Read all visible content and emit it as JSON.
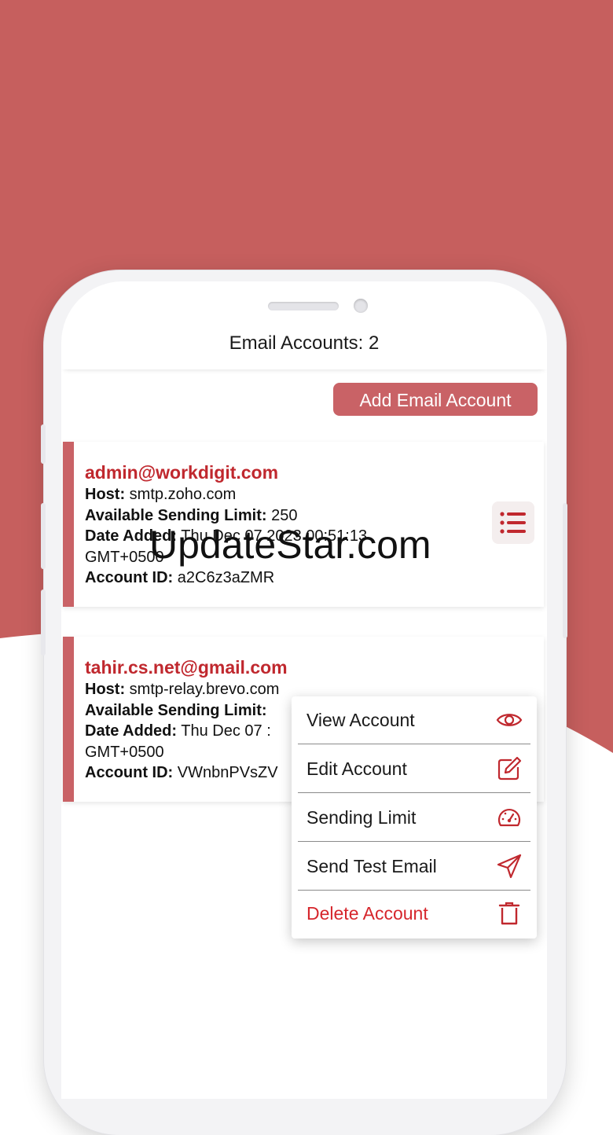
{
  "colors": {
    "background_red": "#c65f5e",
    "accent": "#c96266",
    "email_text": "#c0282e",
    "danger": "#d6262c"
  },
  "header": {
    "title": "Email Accounts: 2"
  },
  "toolbar": {
    "add_label": "Add Email Account"
  },
  "labels": {
    "host": "Host:",
    "limit": "Available Sending Limit:",
    "date": "Date Added:",
    "account_id": "Account ID:"
  },
  "accounts": [
    {
      "email": "admin@workdigit.com",
      "host": "smtp.zoho.com",
      "limit": "250",
      "date_line1": "Thu Dec 07 2023 00:51:13",
      "date_line2": "GMT+0500",
      "account_id": "a2C6z3aZMR",
      "menu_icon": "list-icon"
    },
    {
      "email": "tahir.cs.net@gmail.com",
      "host": "smtp-relay.brevo.com",
      "limit": "",
      "date_line1": "Thu Dec 07 :",
      "date_line2": "GMT+0500",
      "account_id": "VWnbnPVsZV"
    }
  ],
  "context_menu": {
    "items": [
      {
        "label": "View Account",
        "icon": "eye-icon"
      },
      {
        "label": "Edit Account",
        "icon": "edit-icon"
      },
      {
        "label": "Sending Limit",
        "icon": "speedometer-icon"
      },
      {
        "label": "Send Test Email",
        "icon": "send-icon"
      },
      {
        "label": "Delete Account",
        "icon": "trash-icon"
      }
    ]
  },
  "watermark": "UpdateStar.com"
}
